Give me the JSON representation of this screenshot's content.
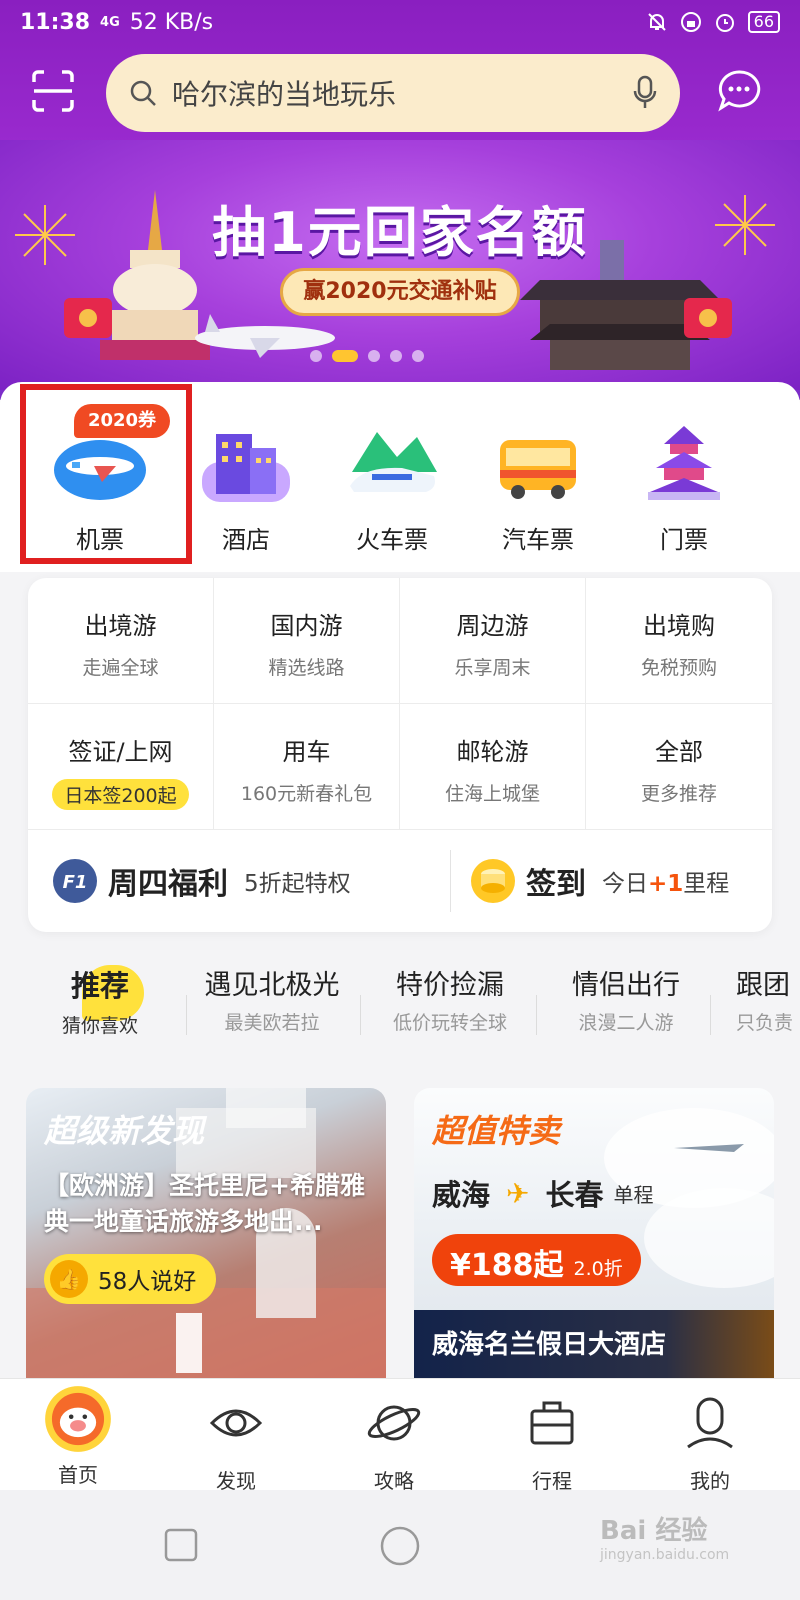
{
  "status_bar": {
    "time": "11:38",
    "network": "4G",
    "speed": "52 KB/s",
    "battery": "66"
  },
  "search": {
    "placeholder": "哈尔滨的当地玩乐"
  },
  "banner": {
    "title": "抽1元回家名额",
    "subtitle": "赢2020元交通补贴",
    "active_page": 1
  },
  "categories": [
    {
      "label": "机票",
      "badge": "2020券"
    },
    {
      "label": "酒店"
    },
    {
      "label": "火车票"
    },
    {
      "label": "汽车票"
    },
    {
      "label": "门票"
    }
  ],
  "grid": [
    {
      "title": "出境游",
      "sub": "走遍全球"
    },
    {
      "title": "国内游",
      "sub": "精选线路"
    },
    {
      "title": "周边游",
      "sub": "乐享周末"
    },
    {
      "title": "出境购",
      "sub": "免税预购"
    },
    {
      "title": "签证/上网",
      "sub": "日本签200起"
    },
    {
      "title": "用车",
      "sub": "160元新春礼包"
    },
    {
      "title": "邮轮游",
      "sub": "住海上城堡"
    },
    {
      "title": "全部",
      "sub": "更多推荐"
    }
  ],
  "promos": {
    "thursday": {
      "badge": "F1",
      "name": "周四福利",
      "desc": "5折起特权"
    },
    "checkin": {
      "name": "签到",
      "desc_prefix": "今日",
      "desc_highlight": "+1",
      "desc_suffix": "里程"
    }
  },
  "tabs": [
    {
      "title": "推荐",
      "sub": "猜你喜欢"
    },
    {
      "title": "遇见北极光",
      "sub": "最美欧若拉"
    },
    {
      "title": "特价捡漏",
      "sub": "低价玩转全球"
    },
    {
      "title": "情侣出行",
      "sub": "浪漫二人游"
    },
    {
      "title": "跟团",
      "sub": "只负责"
    }
  ],
  "feed": {
    "left": {
      "tag": "超级新发现",
      "title": "【欧洲游】圣托里尼+希腊雅典一地童话旅游多地出...",
      "likes": "58人说好"
    },
    "right": {
      "tag": "超值特卖",
      "from": "威海",
      "to": "长春",
      "trip_type": "单程",
      "price": "¥188起",
      "discount": "2.0折",
      "hotel": "威海名兰假日大酒店"
    }
  },
  "bottom_nav": [
    {
      "label": "首页",
      "icon": "home-pig-icon"
    },
    {
      "label": "发现",
      "icon": "eye-icon"
    },
    {
      "label": "攻略",
      "icon": "planet-icon"
    },
    {
      "label": "行程",
      "icon": "suitcase-icon"
    },
    {
      "label": "我的",
      "icon": "user-icon"
    }
  ],
  "watermark": {
    "text": "Bai 经验",
    "url": "jingyan.baidu.com"
  },
  "colors": {
    "header": "#9b2bd0",
    "accent_yellow": "#ffe13c",
    "accent_orange": "#f0430c",
    "highlight_red": "#e02020"
  }
}
